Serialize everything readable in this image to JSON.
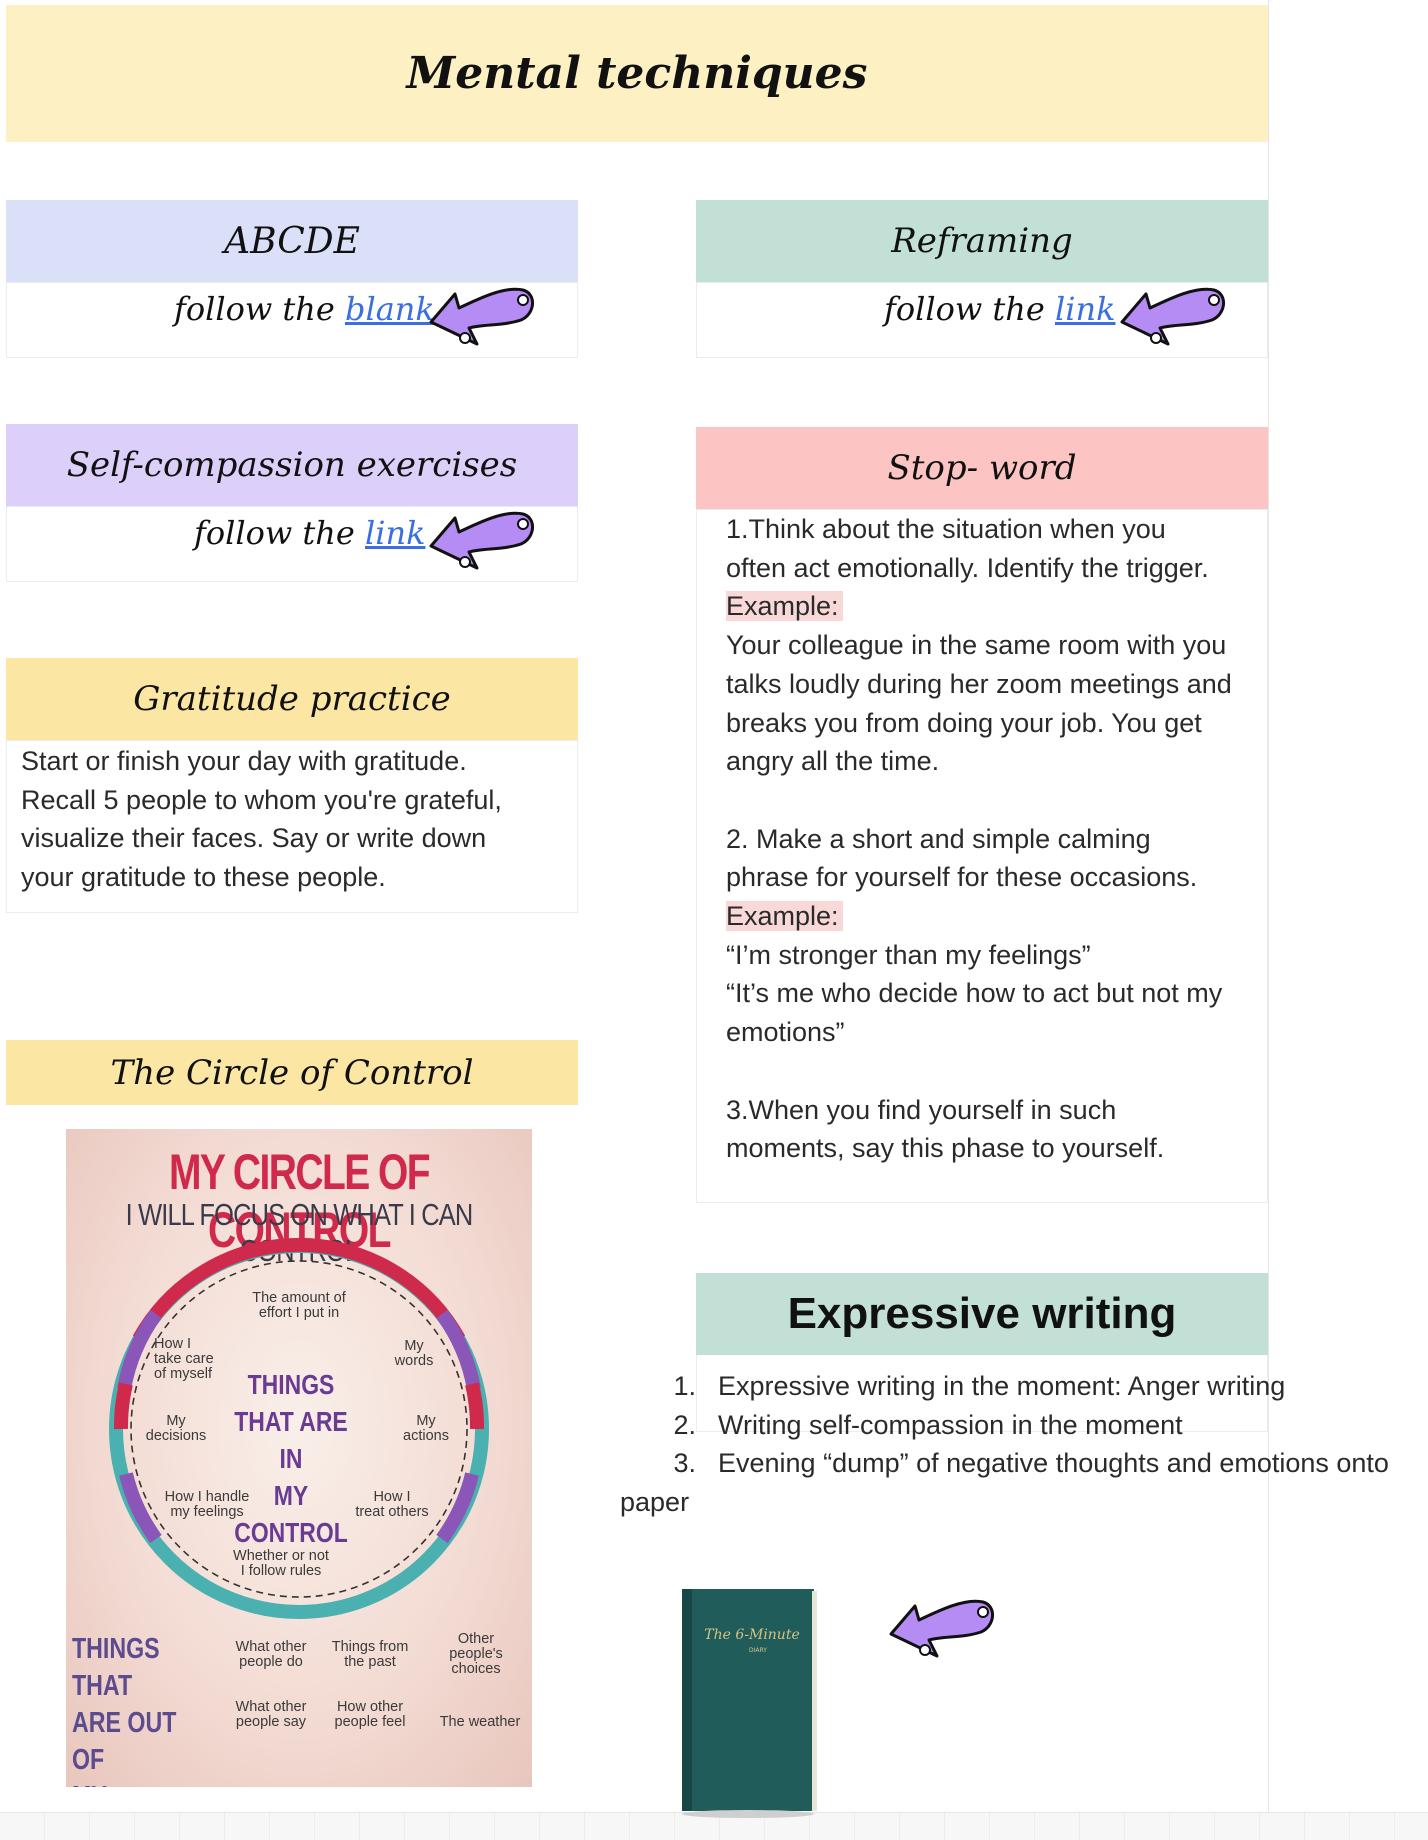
{
  "title": "Mental techniques",
  "cards": {
    "abcde": {
      "heading": "ABCDE",
      "follow_prefix": "follow the",
      "link_text": "blank"
    },
    "reframing": {
      "heading": "Reframing",
      "follow_prefix": "follow the",
      "link_text": "link"
    },
    "self_compassion": {
      "heading": "Self-compassion exercises",
      "follow_prefix": "follow the",
      "link_text": "link"
    },
    "stop_word": {
      "heading": "Stop- word",
      "step1_line1": "1.Think about the situation when you",
      "step1_line2": "often act emotionally. Identify the trigger.",
      "example_label": "Example:",
      "ex1_line1": "Your colleague in the same room with you",
      "ex1_line2": "talks loudly during her zoom meetings and",
      "ex1_line3": "breaks you from doing your job. You get",
      "ex1_line4": "angry all the time.",
      "step2_line1": "2. Make a short and simple calming",
      "step2_line2": "phrase for yourself for these occasions.",
      "example_label_2": "Example:",
      "ex2_line1": "“I’m stronger than my feelings”",
      "ex2_line2": "“It’s me who decide how to act but not my",
      "ex2_line3": "emotions”",
      "step3_line1": "3.When you find yourself in such",
      "step3_line2": "moments, say this phase to yourself."
    },
    "gratitude": {
      "heading": "Gratitude practice",
      "line1": "Start or finish your day with gratitude.",
      "line2": "Recall 5 people to whom you're grateful,",
      "line3": "visualize their faces. Say or write down",
      "line4": "your gratitude to these people."
    },
    "circle_of_control": {
      "heading": "The Circle of Control"
    },
    "expressive_writing": {
      "heading": "Expressive writing",
      "items": [
        {
          "num": "1.",
          "text": "Expressive writing in the moment: Anger writing"
        },
        {
          "num": "2.",
          "text": "Writing self-compassion in the moment"
        },
        {
          "num": "3.",
          "text": "Evening “dump” of negative thoughts and emotions onto"
        }
      ],
      "wrap": "paper"
    }
  },
  "poster": {
    "title": "MY CIRCLE OF CONTROL",
    "subtitle": "I WILL FOCUS ON WHAT I CAN CONTROL",
    "inner": {
      "effort": "The amount of\neffort I put in",
      "care": "How I\ntake care\nof myself",
      "words": "My\nwords",
      "decisions": "My\ndecisions",
      "actions": "My\nactions",
      "feelings": "How I handle\nmy feelings",
      "treat": "How I\ntreat others",
      "rules": "Whether or not\nI follow rules"
    },
    "center": "THINGS\nTHAT ARE IN\nMY CONTROL",
    "outside_heading": "THINGS THAT\nARE OUT OF\nMY CONTROL",
    "outside": {
      "others_do": "What other\npeople do",
      "past": "Things from\nthe past",
      "choices": "Other\npeople's\nchoices",
      "others_say": "What other\npeople say",
      "others_feel": "How other\npeople feel",
      "weather": "The weather"
    }
  },
  "diary": {
    "cover_title": "The 6-Minute",
    "cover_sub": "DIARY"
  },
  "colors": {
    "title_bg": "#fdf0c3",
    "abcde_bg": "#d9e0f8",
    "reframing_bg": "#c3e0d6",
    "self_bg": "#dcd0fa",
    "stop_bg": "#fcc4c3",
    "gratitude_bg": "#fbe6a4",
    "link": "#3b6fe0",
    "arrow": "#b48cf4",
    "diary": "#1f5c5a"
  },
  "icons": [
    "purple-arrow-sticker-icon"
  ]
}
